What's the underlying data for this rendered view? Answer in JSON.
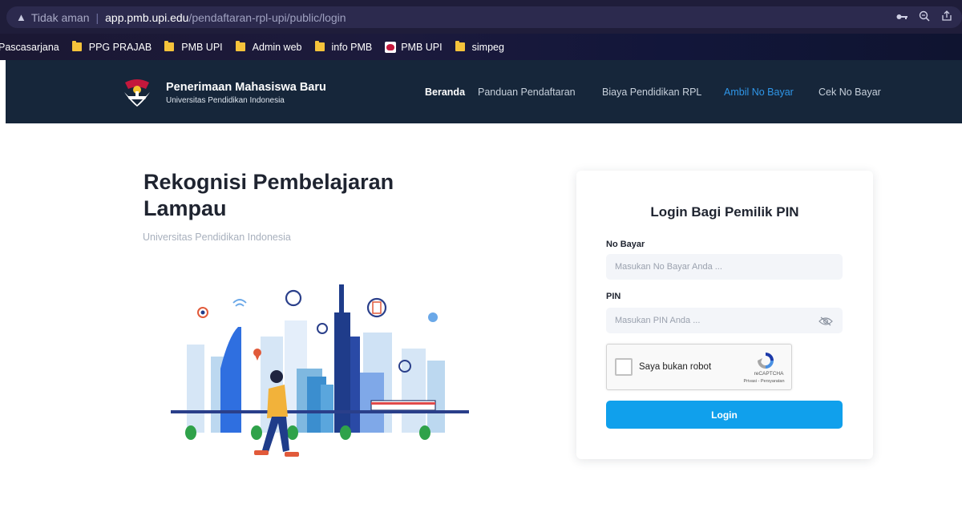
{
  "browser": {
    "warning_icon": "warning-triangle-icon",
    "insecure_label": "Tidak aman",
    "url_host": "app.pmb.upi.edu",
    "url_path": "/pendaftaran-rpl-upi/public/login",
    "icons": [
      "key-icon",
      "zoom-icon",
      "share-icon"
    ]
  },
  "bookmarks": [
    {
      "label": "Pascasarjana",
      "icon": "none"
    },
    {
      "label": "PPG PRAJAB",
      "icon": "folder-icon"
    },
    {
      "label": "PMB UPI",
      "icon": "folder-icon"
    },
    {
      "label": "Admin web",
      "icon": "folder-icon"
    },
    {
      "label": "info PMB",
      "icon": "folder-icon"
    },
    {
      "label": "PMB UPI",
      "icon": "pmb-logo-icon"
    },
    {
      "label": "simpeg",
      "icon": "folder-icon"
    }
  ],
  "site": {
    "brand_title": "Penerimaan Mahasiswa Baru",
    "brand_subtitle": "Universitas Pendidikan Indonesia",
    "nav": [
      {
        "label": "Beranda",
        "state": "active"
      },
      {
        "label": "Panduan Pendaftaran",
        "state": "normal"
      },
      {
        "label": "Biaya Pendidikan RPL",
        "state": "normal"
      },
      {
        "label": "Ambil No Bayar",
        "state": "highlight"
      },
      {
        "label": "Cek No Bayar",
        "state": "normal"
      }
    ]
  },
  "hero": {
    "title": "Rekognisi Pembelajaran Lampau",
    "subtitle": "Universitas Pendidikan Indonesia"
  },
  "login": {
    "title": "Login Bagi Pemilik PIN",
    "no_bayar_label": "No Bayar",
    "no_bayar_placeholder": "Masukan No Bayar Anda ...",
    "pin_label": "PIN",
    "pin_placeholder": "Masukan PIN Anda ...",
    "captcha_label": "Saya bukan robot",
    "captcha_brand": "reCAPTCHA",
    "captcha_links": "Privasi - Persyaratan",
    "button_label": "Login"
  },
  "colors": {
    "nav_bg": "#16263a",
    "accent": "#10a0ec",
    "nav_highlight": "#2f96e8"
  }
}
